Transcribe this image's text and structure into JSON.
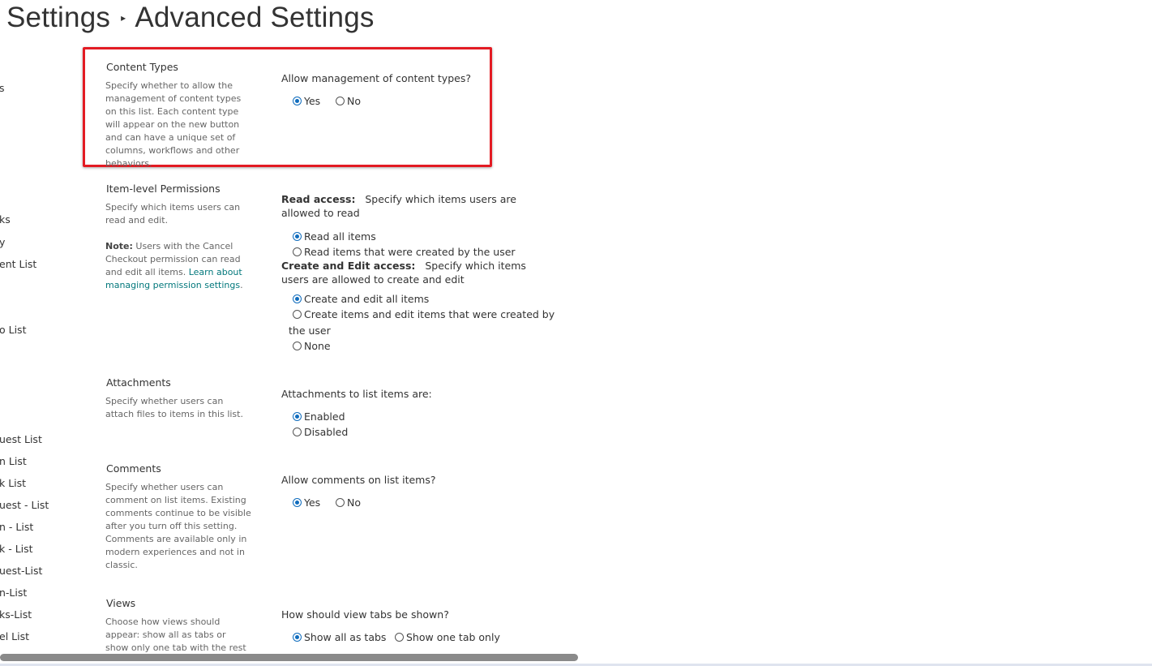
{
  "breadcrumb": {
    "parent": "Settings",
    "separator": "▸",
    "current": "Advanced Settings"
  },
  "nav_items": [
    "s",
    "ks",
    "y",
    "ent List",
    "o List",
    "uest List",
    "n List",
    "k List",
    "uest - List",
    "n - List",
    "k - List",
    "uest-List",
    "n-List",
    "ks-List",
    "el List"
  ],
  "sections": {
    "content_types": {
      "title": "Content Types",
      "description": "Specify whether to allow the management of content types on this list. Each content type will appear on the new button and can have a unique set of columns, workflows and other behaviors.",
      "question": "Allow management of content types?",
      "options": [
        "Yes",
        "No"
      ],
      "selected": "Yes"
    },
    "item_permissions": {
      "title": "Item-level Permissions",
      "description": "Specify which items users can read and edit.",
      "note_label": "Note:",
      "note_text": " Users with the Cancel Checkout permission can read and edit all items. ",
      "note_link": "Learn about managing permission settings",
      "note_end": ".",
      "read_label": "Read access:",
      "read_text": "Specify which items users are allowed to read",
      "read_options": [
        "Read all items",
        "Read items that were created by the user"
      ],
      "read_selected": "Read all items",
      "edit_label": "Create and Edit access:",
      "edit_text": "Specify which items users are allowed to create and edit",
      "edit_options": [
        "Create and edit all items",
        "Create items and edit items that were created by",
        "the user",
        "None"
      ],
      "edit_selected": "Create and edit all items"
    },
    "attachments": {
      "title": "Attachments",
      "description": "Specify whether users can attach files to items in this list.",
      "question": "Attachments to list items are:",
      "options": [
        "Enabled",
        "Disabled"
      ],
      "selected": "Enabled"
    },
    "comments": {
      "title": "Comments",
      "description": "Specify whether users can comment on list items. Existing comments continue to be visible after you turn off this setting. Comments are available only in modern experiences and not in classic.",
      "question": "Allow comments on list items?",
      "options": [
        "Yes",
        "No"
      ],
      "selected": "Yes"
    },
    "views": {
      "title": "Views",
      "description": "Choose how views should appear: show all as tabs or show only one tab with the rest under a more",
      "question": "How should view tabs be shown?",
      "options": [
        "Show all as tabs",
        "Show one tab only"
      ],
      "selected": "Show all as tabs"
    }
  },
  "colors": {
    "accent": "#0f6cbd",
    "highlight_border": "#e31b23",
    "link": "#03787c",
    "text": "#333333",
    "muted": "#666666"
  }
}
